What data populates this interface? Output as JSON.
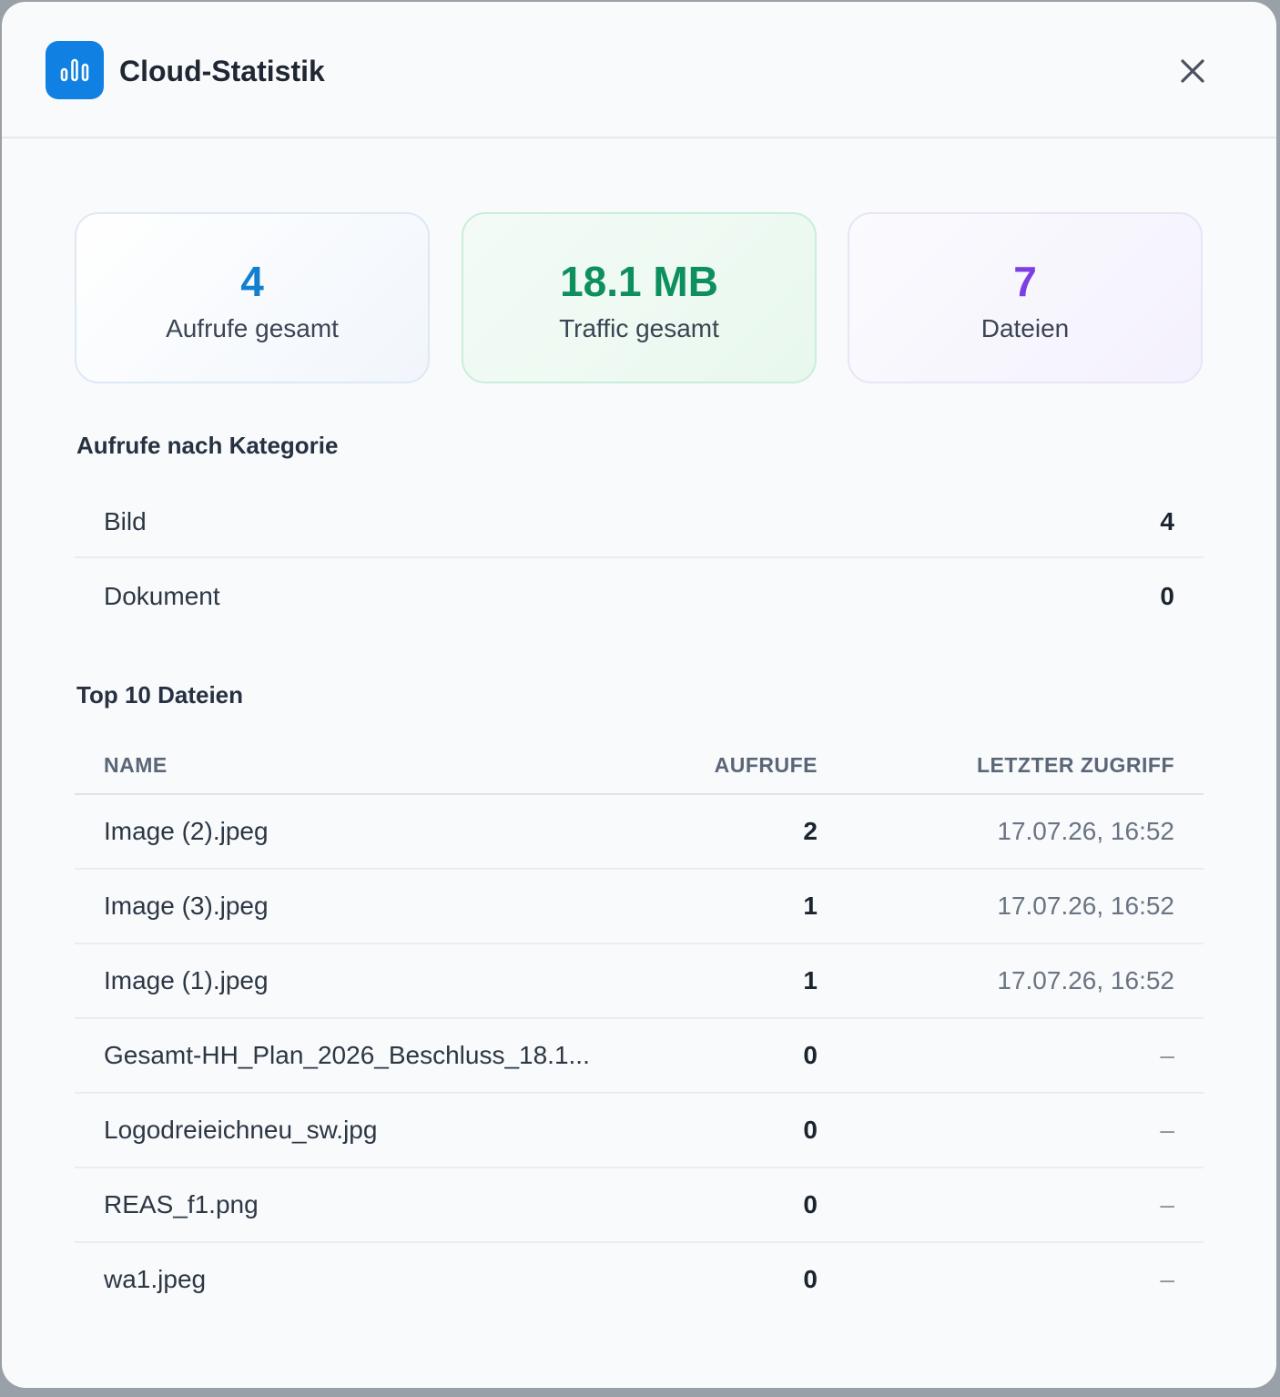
{
  "header": {
    "title": "Cloud-Statistik",
    "icon": "bar-chart-icon",
    "close_icon": "close-icon"
  },
  "colors": {
    "accent_blue": "#1081e2",
    "calls_value": "#137fcf",
    "traffic_value": "#0d8f5e",
    "files_value": "#7b3fe4"
  },
  "stats": [
    {
      "value": "4",
      "label": "Aufrufe gesamt"
    },
    {
      "value": "18.1 MB",
      "label": "Traffic gesamt"
    },
    {
      "value": "7",
      "label": "Dateien"
    }
  ],
  "categories": {
    "title": "Aufrufe nach Kategorie",
    "rows": [
      {
        "name": "Bild",
        "count": "4"
      },
      {
        "name": "Dokument",
        "count": "0"
      }
    ]
  },
  "top_files": {
    "title": "Top 10 Dateien",
    "columns": {
      "name": "NAME",
      "calls": "AUFRUFE",
      "last_access": "LETZTER ZUGRIFF"
    },
    "rows": [
      {
        "name": "Image (2).jpeg",
        "calls": "2",
        "last_access": "17.07.26, 16:52"
      },
      {
        "name": "Image (3).jpeg",
        "calls": "1",
        "last_access": "17.07.26, 16:52"
      },
      {
        "name": "Image (1).jpeg",
        "calls": "1",
        "last_access": "17.07.26, 16:52"
      },
      {
        "name": "Gesamt-HH_Plan_2026_Beschluss_18.1...",
        "calls": "0",
        "last_access": "–"
      },
      {
        "name": "Logodreieichneu_sw.jpg",
        "calls": "0",
        "last_access": "–"
      },
      {
        "name": "REAS_f1.png",
        "calls": "0",
        "last_access": "–"
      },
      {
        "name": "wa1.jpeg",
        "calls": "0",
        "last_access": "–"
      }
    ]
  }
}
